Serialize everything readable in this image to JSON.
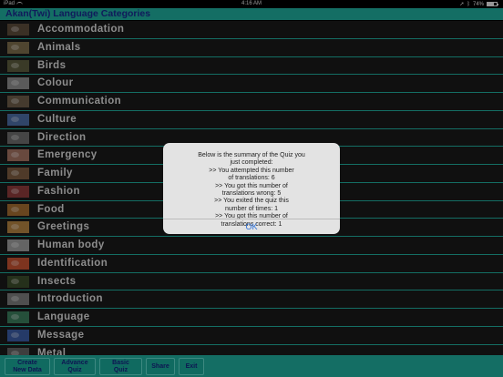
{
  "status_bar": {
    "device": "iPad",
    "time": "4:16 AM",
    "battery_text": "74%"
  },
  "title": "Akan(Twi) Language Categories",
  "categories": [
    {
      "label": "Accommodation",
      "thumb": "#5a4a3a"
    },
    {
      "label": "Animals",
      "thumb": "#7a6a4a"
    },
    {
      "label": "Birds",
      "thumb": "#5a5a3c"
    },
    {
      "label": "Colour",
      "thumb": "#8a8a8a"
    },
    {
      "label": "Communication",
      "thumb": "#6a5a48"
    },
    {
      "label": "Culture",
      "thumb": "#4a6aa0"
    },
    {
      "label": "Direction",
      "thumb": "#6a6a6a"
    },
    {
      "label": "Emergency",
      "thumb": "#a07060"
    },
    {
      "label": "Family",
      "thumb": "#7a5a40"
    },
    {
      "label": "Fashion",
      "thumb": "#8a3a3a"
    },
    {
      "label": "Food",
      "thumb": "#a06a30"
    },
    {
      "label": "Greetings",
      "thumb": "#b08040"
    },
    {
      "label": "Human body",
      "thumb": "#9a9a9a"
    },
    {
      "label": "Identification",
      "thumb": "#c05030"
    },
    {
      "label": "Insects",
      "thumb": "#3a4a2a"
    },
    {
      "label": "Introduction",
      "thumb": "#7a7a7a"
    },
    {
      "label": "Language",
      "thumb": "#3a7a5a"
    },
    {
      "label": "Message",
      "thumb": "#3a5aa0"
    },
    {
      "label": "Metal",
      "thumb": "#606060"
    }
  ],
  "toolbar": {
    "create_new_data": "Create\nNew Data",
    "advance_quiz": "Advance\nQuiz",
    "basic_quiz": "Basic\nQuiz",
    "share": "Share",
    "exit": "Exit"
  },
  "alert": {
    "message": "Below is the summary of the Quiz you\njust completed:\n>> You attempted this number\nof translations:  6\n>> You got this number of\ntranslations wrong:  5\n>> You exited the quiz this\nnumber of times:  1\n>> You got this number of\ntranslations correct:  1",
    "ok_label": "OK"
  },
  "colors": {
    "teal_accent": "#1fa99a",
    "title_text": "#1a2a8c",
    "ok_blue": "#2a6fdb"
  }
}
